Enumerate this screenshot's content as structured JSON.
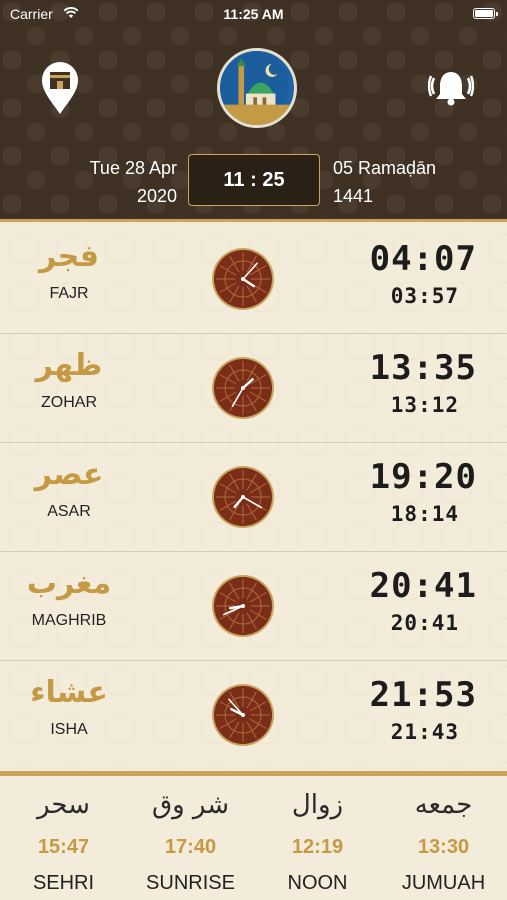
{
  "status_bar": {
    "carrier": "Carrier",
    "time": "11:25 AM"
  },
  "header": {
    "gregorian_date_line1": "Tue 28 Apr",
    "gregorian_date_line2": "2020",
    "current_time": "11 : 25",
    "hijri_date_line1": "05 Ramaḍān",
    "hijri_date_line2": "1441",
    "left_icon": "kaaba-location-icon",
    "center_icon": "mosque-logo-icon",
    "right_icon": "bell-icon"
  },
  "prayers": [
    {
      "name_ar": "فجر",
      "name_en": "FAJR",
      "time": "04:07",
      "sub_time": "03:57"
    },
    {
      "name_ar": "ظهر",
      "name_en": "ZOHAR",
      "time": "13:35",
      "sub_time": "13:12"
    },
    {
      "name_ar": "عصر",
      "name_en": "ASAR",
      "time": "19:20",
      "sub_time": "18:14"
    },
    {
      "name_ar": "مغرب",
      "name_en": "MAGHRIB",
      "time": "20:41",
      "sub_time": "20:41"
    },
    {
      "name_ar": "عشاء",
      "name_en": "ISHA",
      "time": "21:53",
      "sub_time": "21:43"
    }
  ],
  "footer": [
    {
      "name_ar": "سحر",
      "time": "15:47",
      "name_en": "SEHRI"
    },
    {
      "name_ar": "شر وق",
      "time": "17:40",
      "name_en": "SUNRISE"
    },
    {
      "name_ar": "زوال",
      "time": "12:19",
      "name_en": "NOON"
    },
    {
      "name_ar": "جمعه",
      "time": "13:30",
      "name_en": "JUMUAH"
    }
  ],
  "colors": {
    "header_brown": "#3f3123",
    "gold": "#c59a44",
    "cream": "#f4ecda",
    "clock_face": "#7a2e17"
  }
}
